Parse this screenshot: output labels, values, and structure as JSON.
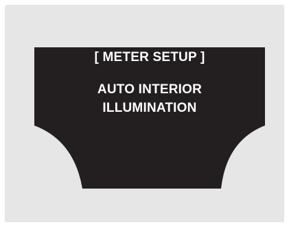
{
  "display": {
    "title": "[ METER SETUP ]",
    "line1": "AUTO INTERIOR",
    "line2": "ILLUMINATION",
    "up_icon": "triangle-up-icon",
    "down_icon": "triangle-down-icon"
  },
  "colors": {
    "outer_bg": "#ffffff",
    "panel_bg": "#e6e6e6",
    "screen": "#231f20",
    "text": "#ffffff"
  }
}
